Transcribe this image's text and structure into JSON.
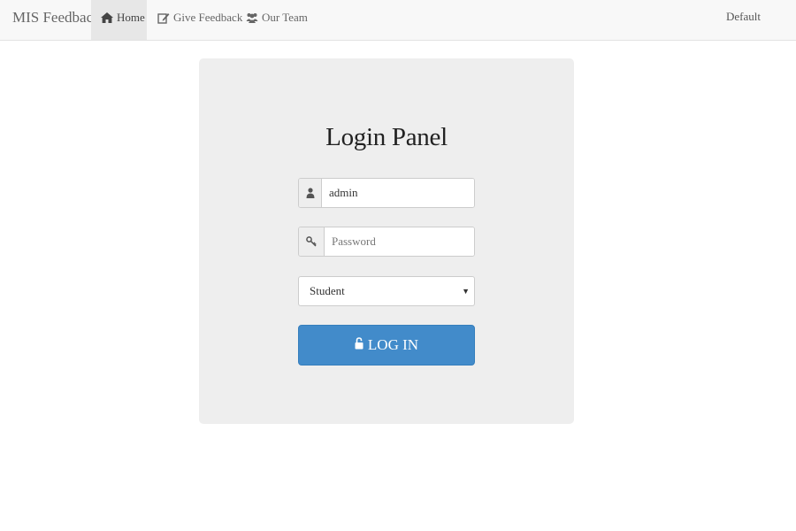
{
  "navbar": {
    "brand": "MIS Feedback",
    "items": [
      {
        "label": "Home",
        "icon": "home-icon",
        "active": true
      },
      {
        "label": "Give Feedback",
        "icon": "edit-icon",
        "active": false
      },
      {
        "label": "Our Team",
        "icon": "users-icon",
        "active": false
      }
    ],
    "right_label": "Default"
  },
  "login": {
    "title": "Login Panel",
    "username": {
      "value": "admin",
      "icon": "user-icon"
    },
    "password": {
      "value": "",
      "placeholder": "Password",
      "icon": "key-icon"
    },
    "role_select": {
      "selected": "Student",
      "icon": "caret-down-icon"
    },
    "submit_label": "LOG IN",
    "submit_icon": "unlock-icon"
  },
  "colors": {
    "navbar_bg": "#f8f8f8",
    "nav_active_bg": "#e7e7e7",
    "panel_bg": "#eeeeee",
    "button_primary": "#428bca"
  }
}
